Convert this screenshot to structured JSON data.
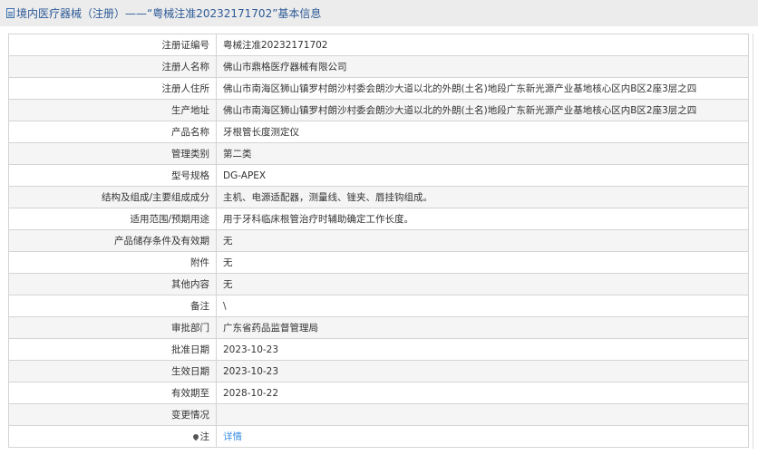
{
  "header": {
    "title": "境内医疗器械（注册）——“粤械注准20232171702”基本信息"
  },
  "rows": [
    {
      "label": "注册证编号",
      "value": "粤械注准20232171702"
    },
    {
      "label": "注册人名称",
      "value": "佛山市鼎格医疗器械有限公司"
    },
    {
      "label": "注册人住所",
      "value": "佛山市南海区狮山镇罗村朗沙村委会朗沙大道以北的外朗(土名)地段广东新光源产业基地核心区内B区2座3层之四"
    },
    {
      "label": "生产地址",
      "value": "佛山市南海区狮山镇罗村朗沙村委会朗沙大道以北的外朗(土名)地段广东新光源产业基地核心区内B区2座3层之四"
    },
    {
      "label": "产品名称",
      "value": "牙根管长度测定仪"
    },
    {
      "label": "管理类别",
      "value": "第二类"
    },
    {
      "label": "型号规格",
      "value": "DG-APEX"
    },
    {
      "label": "结构及组成/主要组成成分",
      "value": "主机、电源适配器，测量线、锉夹、唇挂钩组成。"
    },
    {
      "label": "适用范围/预期用途",
      "value": "用于牙科临床根管治疗时辅助确定工作长度。"
    },
    {
      "label": "产品储存条件及有效期",
      "value": "无"
    },
    {
      "label": "附件",
      "value": "无"
    },
    {
      "label": "其他内容",
      "value": "无"
    },
    {
      "label": "备注",
      "value": "\\"
    },
    {
      "label": "审批部门",
      "value": "广东省药品监督管理局"
    },
    {
      "label": "批准日期",
      "value": "2023-10-23"
    },
    {
      "label": "生效日期",
      "value": "2023-10-23"
    },
    {
      "label": "有效期至",
      "value": "2028-10-22"
    },
    {
      "label": "变更情况",
      "value": ""
    }
  ],
  "note": {
    "label": "注",
    "link": "详情"
  }
}
